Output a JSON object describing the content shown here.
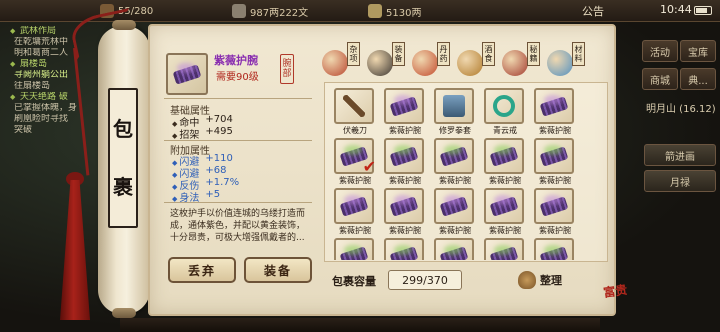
{
  "topbar": {
    "res1": "55/280",
    "res2": "987两222文",
    "res3": "5130两",
    "notice": "公告",
    "time": "10:44"
  },
  "quest": {
    "lines": [
      {
        "text": "武林作局",
        "type": "head"
      },
      {
        "text": "在乾墉荒林中",
        "type": "body"
      },
      {
        "text": "明和葛商二人",
        "type": "body"
      },
      {
        "text": "扇楼岛",
        "type": "head"
      },
      {
        "text": "寻阙州躺公出",
        "type": "hl"
      },
      {
        "text": "往扇楼岛",
        "type": "body"
      },
      {
        "text": "天天绝路 破",
        "type": "head"
      },
      {
        "text": "已掌握体魄，身",
        "type": "body"
      },
      {
        "text": "刷凰睑时寻找",
        "type": "body"
      },
      {
        "text": "突破",
        "type": "body"
      }
    ]
  },
  "rightmenu": {
    "btn_huodong": "活动",
    "btn_baoku": "宝库",
    "btn_shangcheng": "商城",
    "btn_dian": "典...",
    "location": "明月山 (16.12)",
    "btn_tuijian": "箭进画",
    "btn_yuelu": "月禄"
  },
  "scroll": {
    "label_1": "包",
    "label_2": "裹"
  },
  "item": {
    "name": "紫薇护腕",
    "requirement": "需要90级",
    "slot": "腕部",
    "base_title": "基础属性",
    "base_stats": [
      {
        "k": "命中",
        "v": "+704"
      },
      {
        "k": "招架",
        "v": "+495"
      }
    ],
    "extra_title": "附加属性",
    "extra_stats": [
      {
        "k": "闪避",
        "v": "+110"
      },
      {
        "k": "闪避",
        "v": "+68"
      },
      {
        "k": "反伤",
        "v": "+1.7%"
      },
      {
        "k": "身法",
        "v": "+5"
      }
    ],
    "description": "这枚护手以价值连城的乌缕打造而成，通体紫色，并配以黄金装饰，十分昂贵，可极大增强佩戴者的...",
    "discard_label": "丢弃",
    "equip_label": "装备"
  },
  "categories": [
    {
      "tag": "杂项",
      "color": "#b8462e"
    },
    {
      "tag": "装备",
      "color": "#3a3530"
    },
    {
      "tag": "丹药",
      "color": "#c24a2c"
    },
    {
      "tag": "酒食",
      "color": "#b07a2a"
    },
    {
      "tag": "秘籍",
      "color": "#a23a2e"
    },
    {
      "tag": "材料",
      "color": "#4f8fc0"
    }
  ],
  "grid": {
    "cells": [
      {
        "label": "伏羲刀",
        "icon": "blade-icon"
      },
      {
        "label": "紫薇护腕",
        "icon": "bracer-icon"
      },
      {
        "label": "修罗拳套",
        "icon": "gauntlet-icon"
      },
      {
        "label": "青云戒",
        "icon": "ring-icon"
      },
      {
        "label": "紫薇护腕",
        "icon": "bracer-icon"
      },
      {
        "label": "紫薇护腕",
        "icon": "bracer-icon",
        "selected": true
      },
      {
        "label": "紫薇护腕",
        "icon": "bracer-icon"
      },
      {
        "label": "紫薇护腕",
        "icon": "bracer-icon"
      },
      {
        "label": "紫薇护腕",
        "icon": "bracer-icon"
      },
      {
        "label": "紫薇护腕",
        "icon": "bracer-icon"
      },
      {
        "label": "紫薇护腕",
        "icon": "bracer-icon"
      },
      {
        "label": "紫薇护腕",
        "icon": "bracer-icon"
      },
      {
        "label": "紫薇护腕",
        "icon": "bracer-icon"
      },
      {
        "label": "紫薇护腕",
        "icon": "bracer-icon"
      },
      {
        "label": "紫薇护腕",
        "icon": "bracer-icon"
      },
      {
        "label": "紫薇护腕",
        "icon": "bracer-icon"
      },
      {
        "label": "紫薇护腕",
        "icon": "bracer-icon"
      },
      {
        "label": "紫薇护腕",
        "icon": "bracer-icon"
      },
      {
        "label": "紫薇护腕",
        "icon": "bracer-icon"
      },
      {
        "label": "紫薇护腕",
        "icon": "bracer-icon"
      }
    ]
  },
  "footer": {
    "capacity_label": "包裹容量",
    "capacity_value": "299/370",
    "sort_label": "整理"
  },
  "seal": "富贵"
}
